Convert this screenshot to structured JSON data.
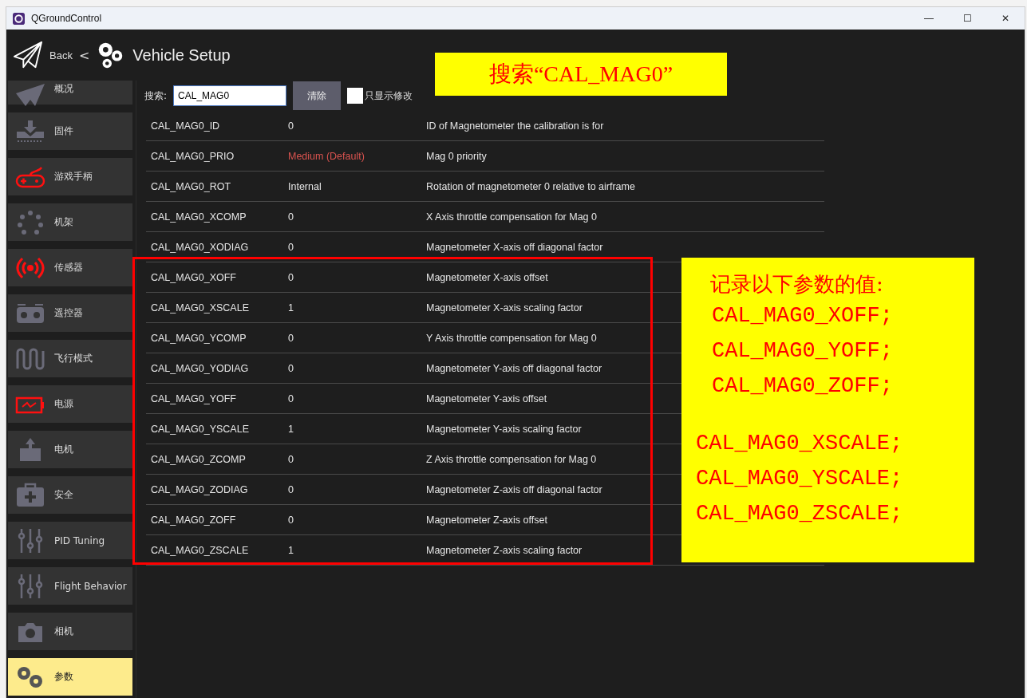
{
  "window": {
    "title": "QGroundControl",
    "controls": [
      "—",
      "☐",
      "✕"
    ]
  },
  "header": {
    "back": "Back",
    "separator": "<",
    "title": "Vehicle Setup"
  },
  "sidebar": {
    "items": [
      {
        "label": "概况",
        "kind": "plane",
        "warning": false,
        "selected": false
      },
      {
        "label": "固件",
        "kind": "firmware",
        "warning": false,
        "selected": false
      },
      {
        "label": "游戏手柄",
        "kind": "joystick",
        "warning": true,
        "selected": false
      },
      {
        "label": "机架",
        "kind": "airframe",
        "warning": false,
        "selected": false
      },
      {
        "label": "传感器",
        "kind": "sensors",
        "warning": true,
        "selected": false
      },
      {
        "label": "遥控器",
        "kind": "radio",
        "warning": false,
        "selected": false
      },
      {
        "label": "飞行模式",
        "kind": "modes",
        "warning": false,
        "selected": false
      },
      {
        "label": "电源",
        "kind": "power",
        "warning": true,
        "selected": false
      },
      {
        "label": "电机",
        "kind": "motor",
        "warning": false,
        "selected": false
      },
      {
        "label": "安全",
        "kind": "safety",
        "warning": false,
        "selected": false
      },
      {
        "label": "PID Tuning",
        "kind": "tuning",
        "warning": false,
        "selected": false
      },
      {
        "label": "Flight Behavior",
        "kind": "tuning",
        "warning": false,
        "selected": false
      },
      {
        "label": "相机",
        "kind": "camera",
        "warning": false,
        "selected": false
      },
      {
        "label": "参数",
        "kind": "gears",
        "warning": false,
        "selected": true
      }
    ]
  },
  "search": {
    "label": "搜索:",
    "value": "CAL_MAG0",
    "clear_button": "清除",
    "modified_only": {
      "label": "只显示修改",
      "checked": false
    }
  },
  "table": {
    "rows": [
      {
        "name": "CAL_MAG0_ID",
        "value": "0",
        "description": "ID of Magnetometer the calibration is for",
        "value_highlighted": false
      },
      {
        "name": "CAL_MAG0_PRIO",
        "value": "Medium (Default)",
        "description": "Mag 0 priority",
        "value_highlighted": true
      },
      {
        "name": "CAL_MAG0_ROT",
        "value": "Internal",
        "description": "Rotation of magnetometer 0 relative to airframe",
        "value_highlighted": false
      },
      {
        "name": "CAL_MAG0_XCOMP",
        "value": "0",
        "description": "X Axis throttle compensation for Mag 0",
        "value_highlighted": false
      },
      {
        "name": "CAL_MAG0_XODIAG",
        "value": "0",
        "description": "Magnetometer X-axis off diagonal factor",
        "value_highlighted": false
      },
      {
        "name": "CAL_MAG0_XOFF",
        "value": "0",
        "description": "Magnetometer X-axis offset",
        "value_highlighted": false
      },
      {
        "name": "CAL_MAG0_XSCALE",
        "value": "1",
        "description": "Magnetometer X-axis scaling factor",
        "value_highlighted": false
      },
      {
        "name": "CAL_MAG0_YCOMP",
        "value": "0",
        "description": "Y Axis throttle compensation for Mag 0",
        "value_highlighted": false
      },
      {
        "name": "CAL_MAG0_YODIAG",
        "value": "0",
        "description": "Magnetometer Y-axis off diagonal factor",
        "value_highlighted": false
      },
      {
        "name": "CAL_MAG0_YOFF",
        "value": "0",
        "description": "Magnetometer Y-axis offset",
        "value_highlighted": false
      },
      {
        "name": "CAL_MAG0_YSCALE",
        "value": "1",
        "description": "Magnetometer Y-axis scaling factor",
        "value_highlighted": false
      },
      {
        "name": "CAL_MAG0_ZCOMP",
        "value": "0",
        "description": "Z Axis throttle compensation for Mag 0",
        "value_highlighted": false
      },
      {
        "name": "CAL_MAG0_ZODIAG",
        "value": "0",
        "description": "Magnetometer Z-axis off diagonal factor",
        "value_highlighted": false
      },
      {
        "name": "CAL_MAG0_ZOFF",
        "value": "0",
        "description": "Magnetometer Z-axis offset",
        "value_highlighted": false
      },
      {
        "name": "CAL_MAG0_ZSCALE",
        "value": "1",
        "description": "Magnetometer Z-axis scaling factor",
        "value_highlighted": false
      }
    ]
  },
  "annotations": {
    "search_note": "搜索“CAL_MAG0”",
    "callout": {
      "heading": "记录以下参数的值:",
      "groups": [
        [
          "CAL_MAG0_XOFF;",
          "CAL_MAG0_YOFF;",
          "CAL_MAG0_ZOFF;"
        ],
        [
          "CAL_MAG0_XSCALE;",
          "CAL_MAG0_YSCALE;",
          "CAL_MAG0_ZSCALE;"
        ]
      ]
    }
  }
}
